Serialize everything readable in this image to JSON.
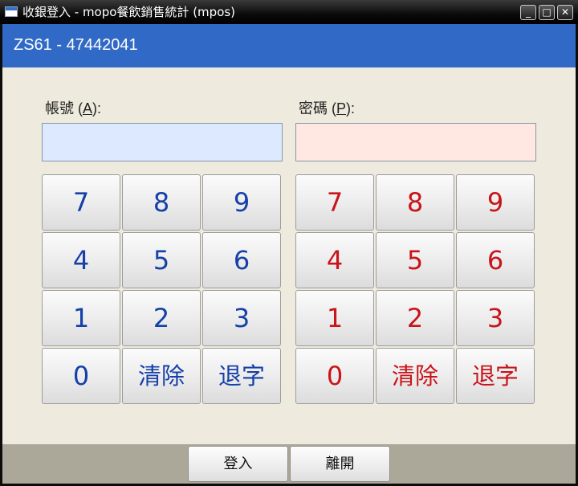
{
  "window": {
    "title": "收銀登入 - mopo餐飲銷售統計 (mpos)",
    "controls": {
      "minimize": "_",
      "maximize": "□",
      "close": "✕"
    }
  },
  "header": {
    "title": "ZS61 - 47442041"
  },
  "account": {
    "label_prefix": "帳號 (",
    "label_mnemonic": "A",
    "label_suffix": "):",
    "value": ""
  },
  "password": {
    "label_prefix": "密碼 (",
    "label_mnemonic": "P",
    "label_suffix": "):",
    "value": ""
  },
  "keypad_account": {
    "keys": [
      "7",
      "8",
      "9",
      "4",
      "5",
      "6",
      "1",
      "2",
      "3",
      "0",
      "清除",
      "退字"
    ]
  },
  "keypad_password": {
    "keys": [
      "7",
      "8",
      "9",
      "4",
      "5",
      "6",
      "1",
      "2",
      "3",
      "0",
      "清除",
      "退字"
    ]
  },
  "footer": {
    "login_label": "登入",
    "exit_label": "離開"
  },
  "colors": {
    "header_bg": "#316ac6",
    "account_field_bg": "#dce9ff",
    "password_field_bg": "#ffe8e1",
    "account_key_text": "#1540a8",
    "password_key_text": "#c8141a",
    "content_bg": "#eeeadd",
    "footer_bg": "#aca899"
  }
}
